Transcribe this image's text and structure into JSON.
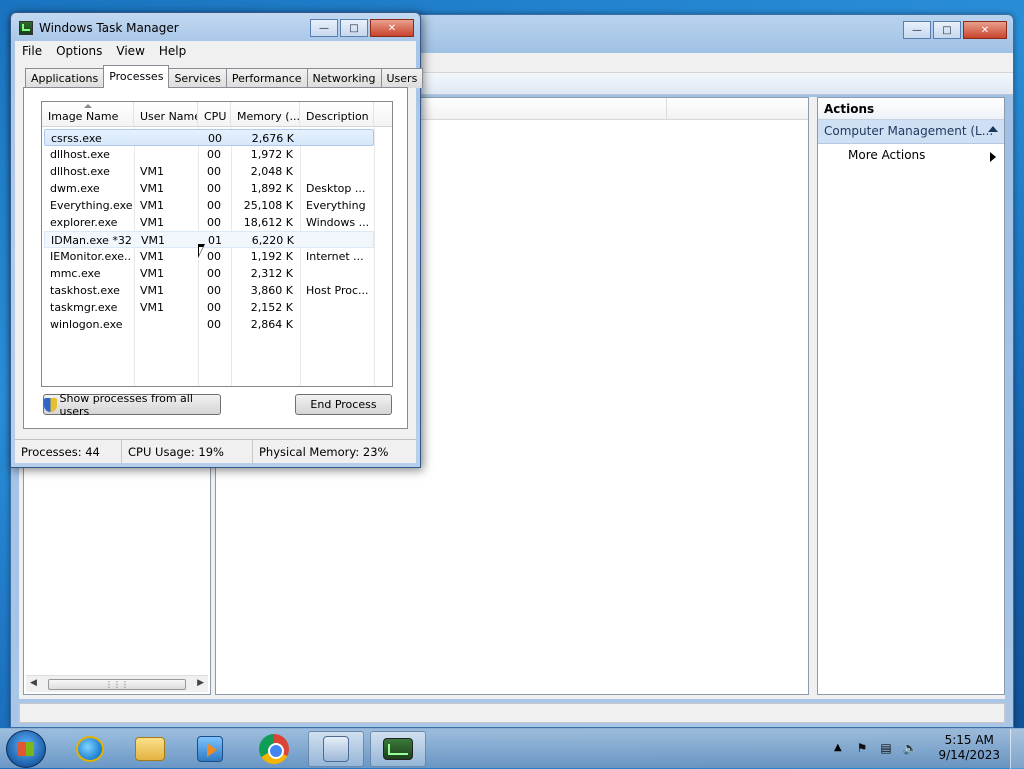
{
  "task_manager": {
    "title": "Windows Task Manager",
    "menu": [
      "File",
      "Options",
      "View",
      "Help"
    ],
    "tabs": [
      "Applications",
      "Processes",
      "Services",
      "Performance",
      "Networking",
      "Users"
    ],
    "active_tab": "Processes",
    "columns": [
      "Image Name",
      "User Name",
      "CPU",
      "Memory (...",
      "Description"
    ],
    "processes": [
      {
        "image": "csrss.exe",
        "user": "",
        "cpu": "00",
        "memory": "2,676 K",
        "description": ""
      },
      {
        "image": "dllhost.exe",
        "user": "",
        "cpu": "00",
        "memory": "1,972 K",
        "description": ""
      },
      {
        "image": "dllhost.exe",
        "user": "VM1",
        "cpu": "00",
        "memory": "2,048 K",
        "description": ""
      },
      {
        "image": "dwm.exe",
        "user": "VM1",
        "cpu": "00",
        "memory": "1,892 K",
        "description": "Desktop ..."
      },
      {
        "image": "Everything.exe",
        "user": "VM1",
        "cpu": "00",
        "memory": "25,108 K",
        "description": "Everything"
      },
      {
        "image": "explorer.exe",
        "user": "VM1",
        "cpu": "00",
        "memory": "18,612 K",
        "description": "Windows ..."
      },
      {
        "image": "IDMan.exe *32",
        "user": "VM1",
        "cpu": "01",
        "memory": "6,220 K",
        "description": ""
      },
      {
        "image": "IEMonitor.exe...",
        "user": "VM1",
        "cpu": "00",
        "memory": "1,192 K",
        "description": "Internet ..."
      },
      {
        "image": "mmc.exe",
        "user": "VM1",
        "cpu": "00",
        "memory": "2,312 K",
        "description": ""
      },
      {
        "image": "taskhost.exe",
        "user": "VM1",
        "cpu": "00",
        "memory": "3,860 K",
        "description": "Host Proc..."
      },
      {
        "image": "taskmgr.exe",
        "user": "VM1",
        "cpu": "00",
        "memory": "2,152 K",
        "description": ""
      },
      {
        "image": "winlogon.exe",
        "user": "",
        "cpu": "00",
        "memory": "2,864 K",
        "description": ""
      }
    ],
    "show_all_button": "Show processes from all users",
    "end_process_button": "End Process",
    "status": {
      "processes": "Processes: 44",
      "cpu": "CPU Usage: 19%",
      "memory": "Physical Memory: 23%"
    }
  },
  "computer_management": {
    "actions_title": "Actions",
    "actions_selected": "Computer Management (L...",
    "actions_more": "More Actions"
  },
  "taskbar": {
    "time": "5:15 AM",
    "date": "9/14/2023",
    "pinned": [
      "internet-explorer-icon",
      "windows-explorer-icon",
      "media-player-icon",
      "chrome-icon",
      "computer-management-icon",
      "task-manager-icon"
    ]
  }
}
